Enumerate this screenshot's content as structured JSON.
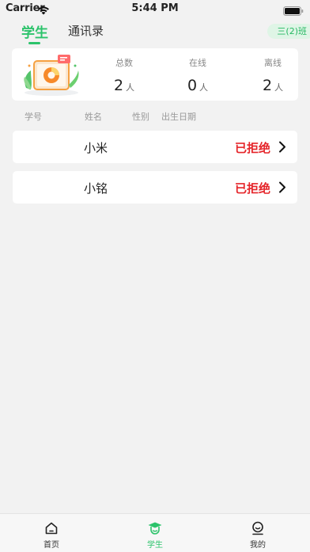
{
  "status_bar": {
    "carrier": "Carrier",
    "time": "5:44 PM"
  },
  "tabs": [
    {
      "label": "学生",
      "active": true
    },
    {
      "label": "通讯录",
      "active": false
    }
  ],
  "class_selector": {
    "label": "三(2)班"
  },
  "summary": {
    "stats": [
      {
        "label": "总数",
        "value": "2",
        "unit": "人"
      },
      {
        "label": "在线",
        "value": "0",
        "unit": "人"
      },
      {
        "label": "离线",
        "value": "2",
        "unit": "人"
      }
    ]
  },
  "columns": [
    "学号",
    "姓名",
    "性别",
    "出生日期"
  ],
  "students": [
    {
      "name": "小米",
      "status": "已拒绝"
    },
    {
      "name": "小铭",
      "status": "已拒绝"
    }
  ],
  "bottom_nav": [
    {
      "label": "首页",
      "icon": "home-icon",
      "active": false
    },
    {
      "label": "学生",
      "icon": "graduation-cap-icon",
      "active": true
    },
    {
      "label": "我的",
      "icon": "profile-icon",
      "active": false
    }
  ],
  "colors": {
    "accent": "#2cc36b",
    "danger": "#e5252a"
  }
}
